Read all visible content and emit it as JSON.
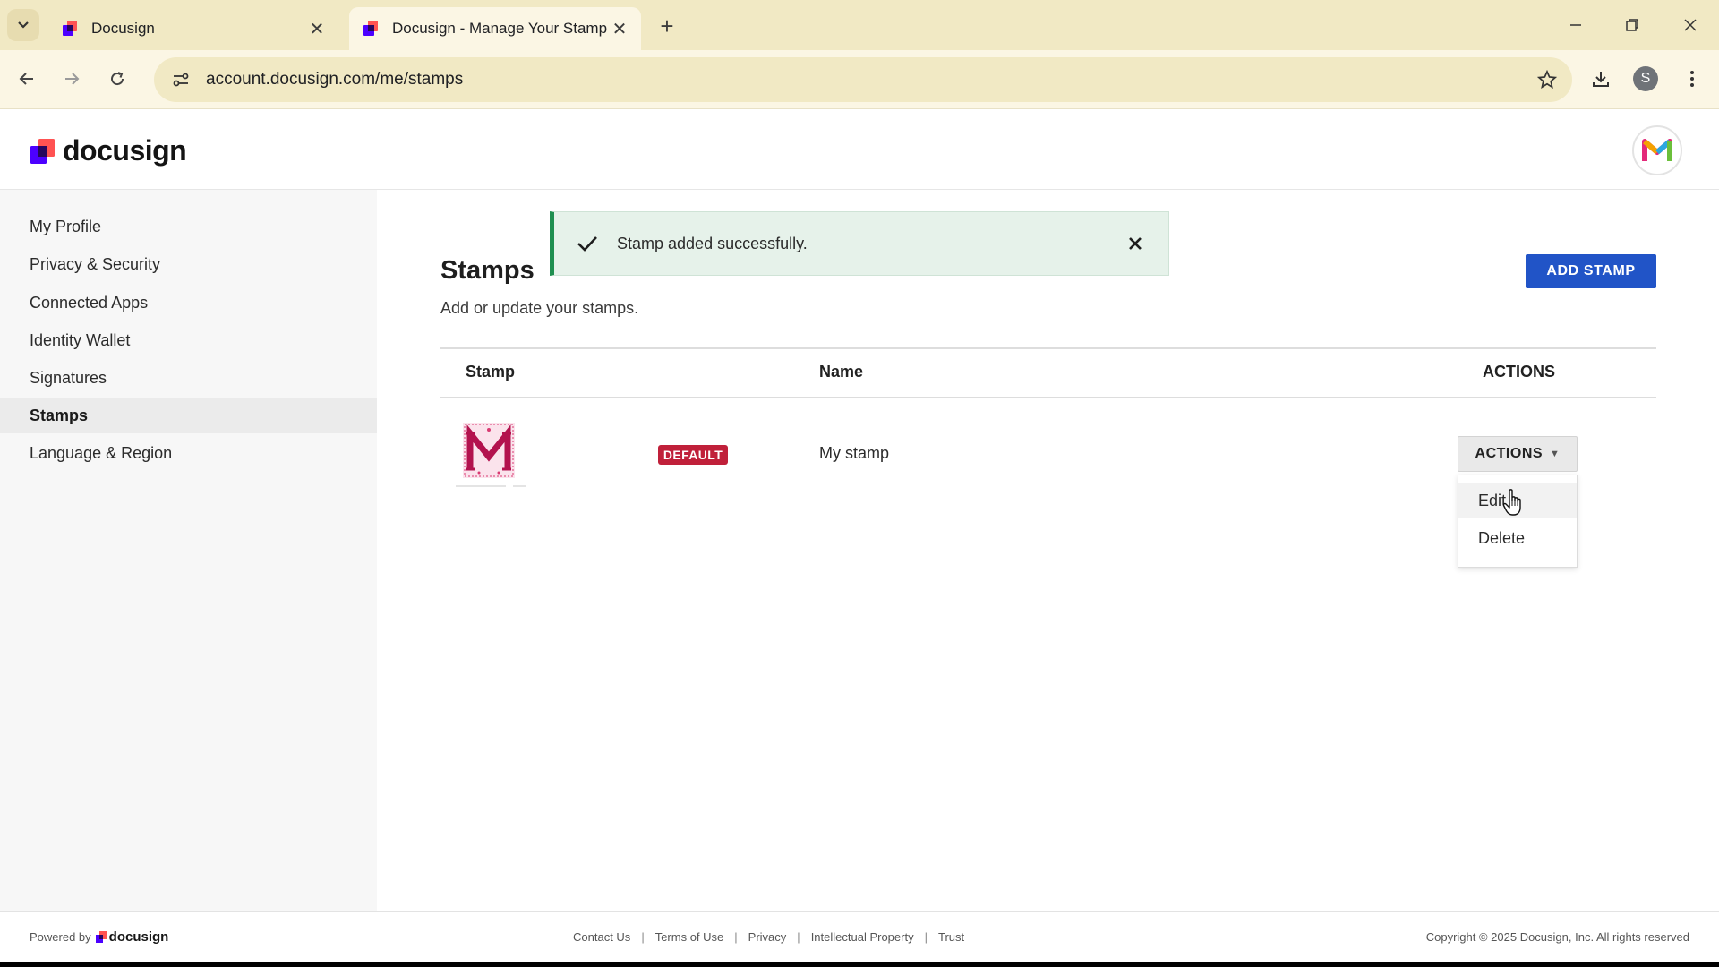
{
  "browser": {
    "tabs": [
      {
        "title": "Docusign"
      },
      {
        "title": "Docusign - Manage Your Stamp"
      }
    ],
    "url": "account.docusign.com/me/stamps",
    "profile_initial": "S"
  },
  "header": {
    "brand": "docusign"
  },
  "sidebar": {
    "items": [
      {
        "label": "My Profile"
      },
      {
        "label": "Privacy & Security"
      },
      {
        "label": "Connected Apps"
      },
      {
        "label": "Identity Wallet"
      },
      {
        "label": "Signatures"
      },
      {
        "label": "Stamps"
      },
      {
        "label": "Language & Region"
      }
    ]
  },
  "toast": {
    "message": "Stamp added successfully."
  },
  "main": {
    "title": "Stamps",
    "subtitle": "Add or update your stamps.",
    "add_button": "ADD STAMP",
    "table": {
      "headers": {
        "stamp": "Stamp",
        "name": "Name",
        "actions": "ACTIONS"
      },
      "rows": [
        {
          "badge": "DEFAULT",
          "name": "My stamp",
          "actions_label": "ACTIONS"
        }
      ]
    },
    "menu": {
      "items": [
        {
          "label": "Edit"
        },
        {
          "label": "Delete"
        }
      ]
    }
  },
  "footer": {
    "powered_by": "Powered by",
    "brand": "docusign",
    "links": [
      "Contact Us",
      "Terms of Use",
      "Privacy",
      "Intellectual Property",
      "Trust"
    ],
    "copyright": "Copyright © 2025 Docusign, Inc. All rights reserved"
  },
  "colors": {
    "primary": "#2154c7",
    "badge_red": "#c0203a",
    "toast_green": "#1f8f50"
  }
}
